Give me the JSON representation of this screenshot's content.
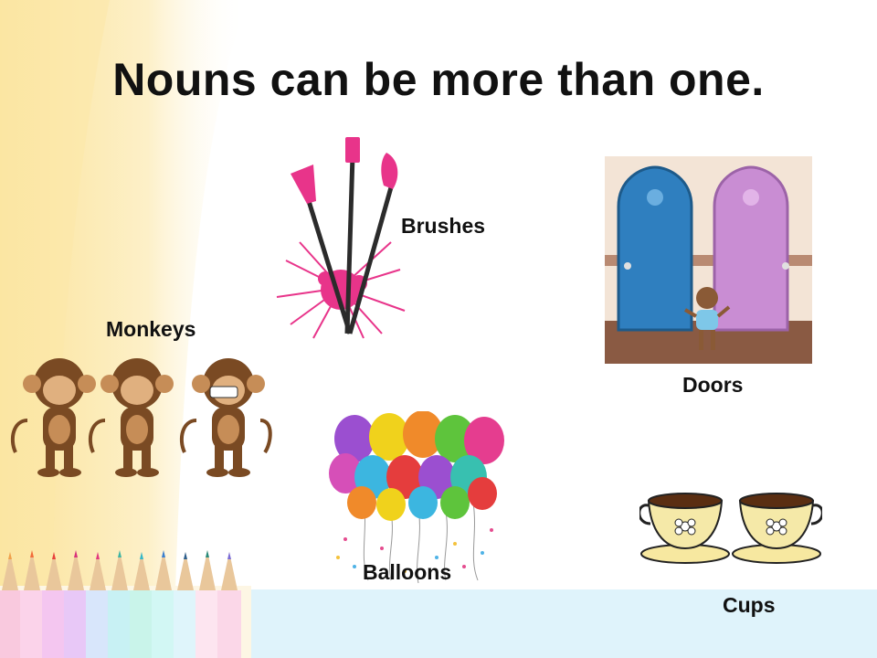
{
  "slide": {
    "title": "Nouns can be more than one.",
    "labels": {
      "brushes": "Brushes",
      "monkeys": "Monkeys",
      "doors": "Doors",
      "balloons": "Balloons",
      "cups": "Cups"
    }
  },
  "colors": {
    "background_accent": "#fbe9a6",
    "bottom_band": "#dff3fb",
    "door_left": "#2f7fbf",
    "door_right": "#c98dd3",
    "brush_pink": "#e83e8c"
  },
  "icons": [
    "brushes-illustration",
    "doors-illustration",
    "monkeys-illustration",
    "balloons-illustration",
    "cups-illustration",
    "pencils-illustration"
  ]
}
